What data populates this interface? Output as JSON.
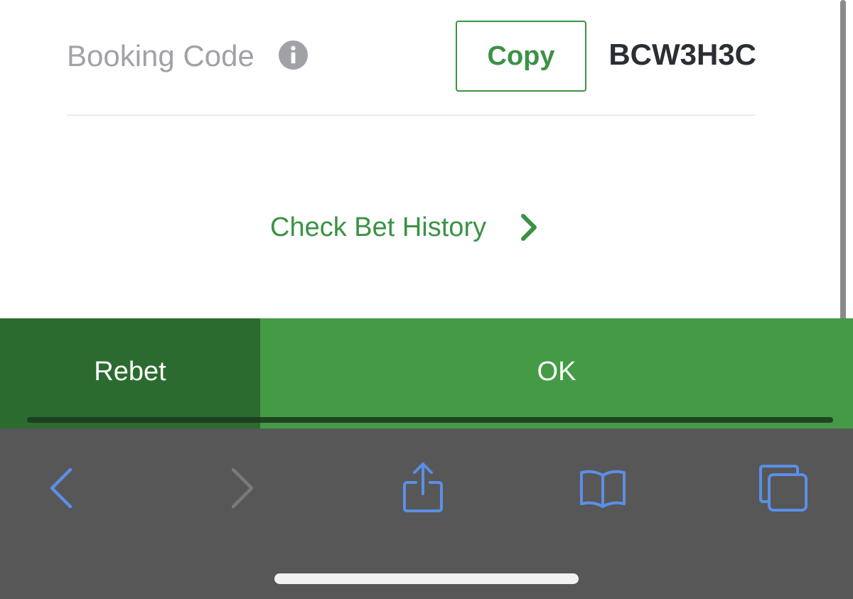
{
  "booking": {
    "label": "Booking Code",
    "copy_label": "Copy",
    "code": "BCW3H3C"
  },
  "links": {
    "bet_history": "Check Bet History"
  },
  "actions": {
    "rebet_label": "Rebet",
    "ok_label": "OK"
  },
  "browser_toolbar": {
    "buttons": [
      "back-icon",
      "forward-icon",
      "share-icon",
      "bookmarks-icon",
      "tabs-icon"
    ],
    "forward_enabled": false
  },
  "colors": {
    "brand_green": "#3a9245",
    "ok_green": "#449a45",
    "rebet_green": "#2c6b2f",
    "toolbar_gray": "#575757",
    "ios_blue": "#5a8fe6"
  }
}
